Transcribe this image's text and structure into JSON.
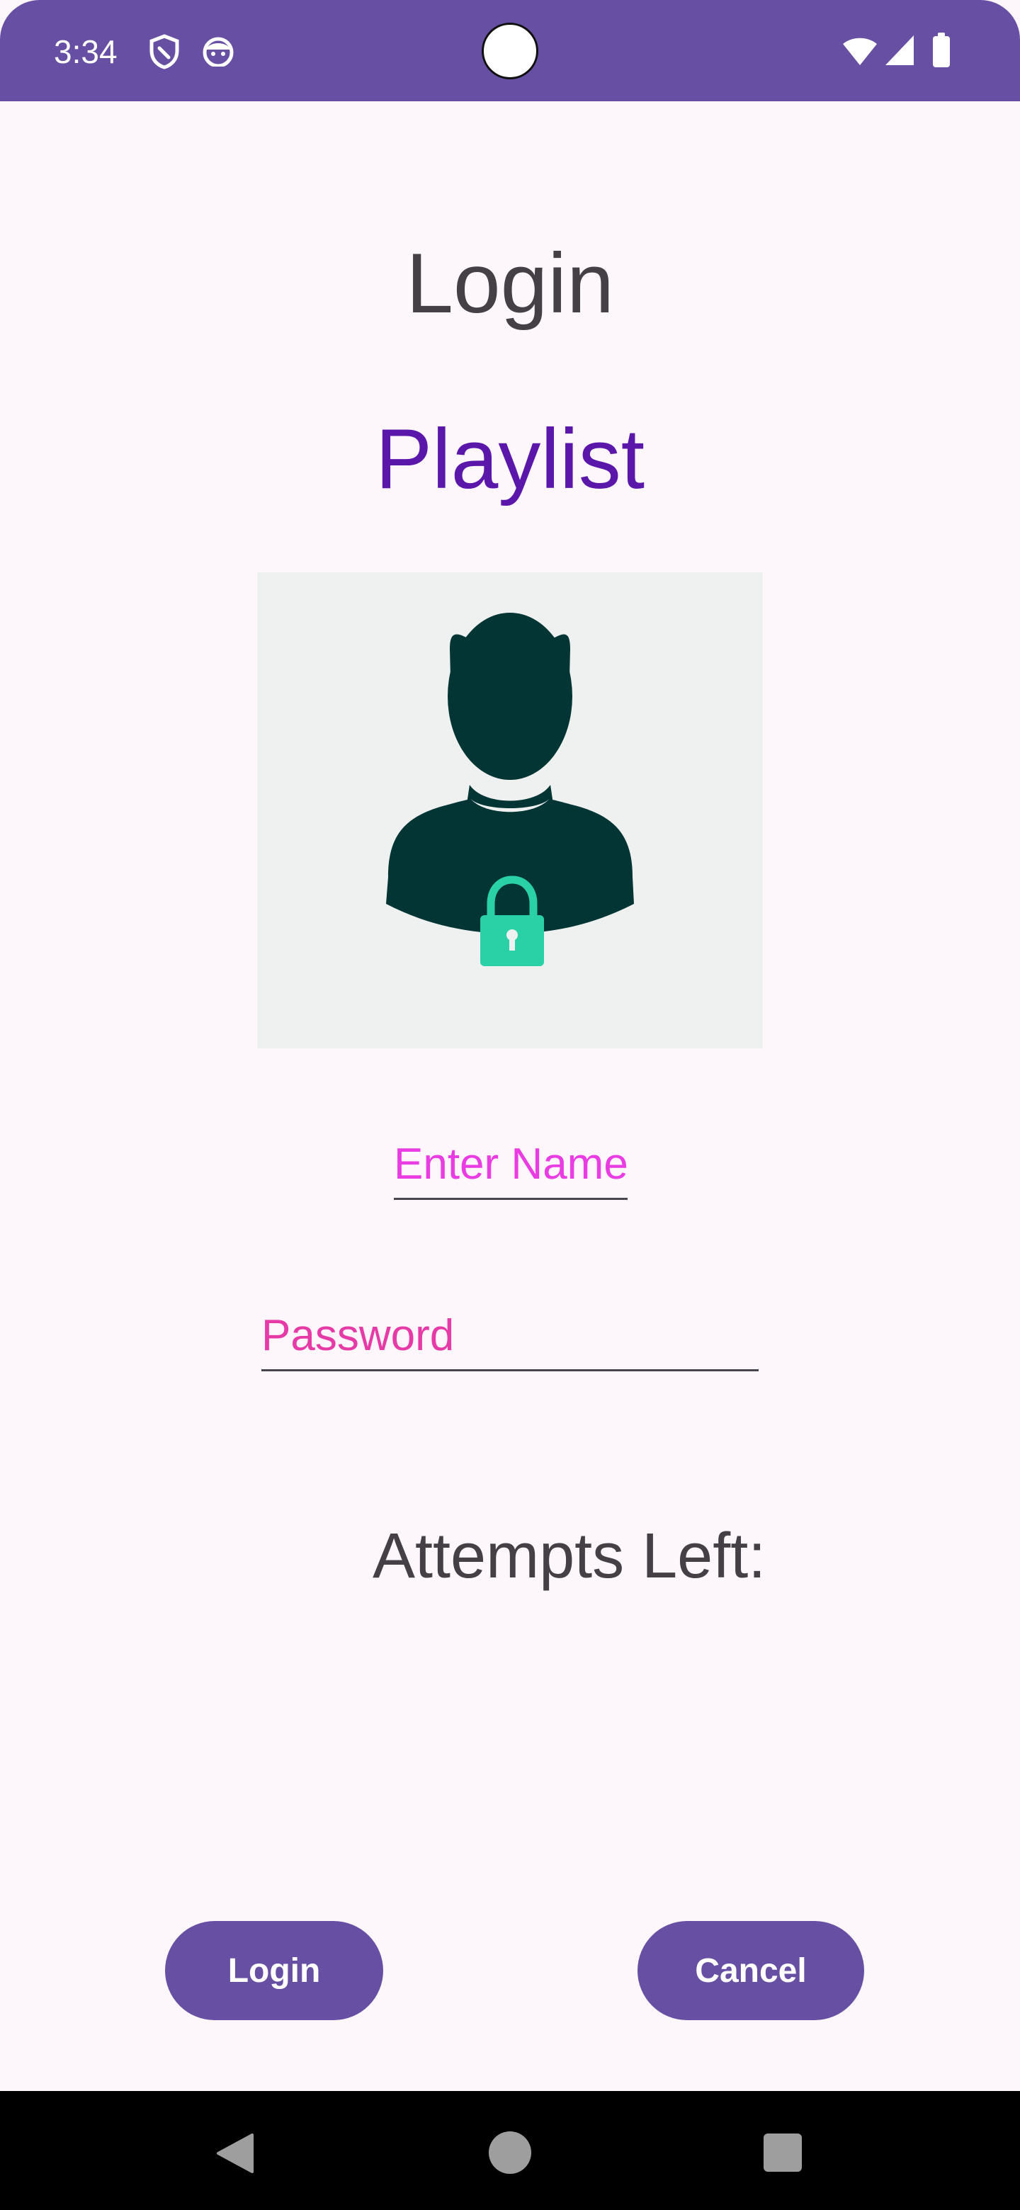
{
  "status_bar": {
    "time": "3:34",
    "icons": [
      "shield-icon",
      "robot-face-icon",
      "wifi-icon",
      "cellular-signal-icon",
      "battery-icon"
    ],
    "color": "#6750a4"
  },
  "header": {
    "title": "Login",
    "subtitle": "Playlist"
  },
  "avatar": {
    "icon": "user-lock-icon",
    "lock_color": "#2ad0a6"
  },
  "form": {
    "name_placeholder": "Enter Name",
    "name_value": "",
    "password_placeholder": "Password",
    "password_value": ""
  },
  "attempts": {
    "label": "Attempts Left:"
  },
  "buttons": {
    "login_label": "Login",
    "cancel_label": "Cancel",
    "color": "#6750a4"
  },
  "nav": {
    "icons": [
      "back-icon",
      "home-icon",
      "recents-icon"
    ]
  }
}
